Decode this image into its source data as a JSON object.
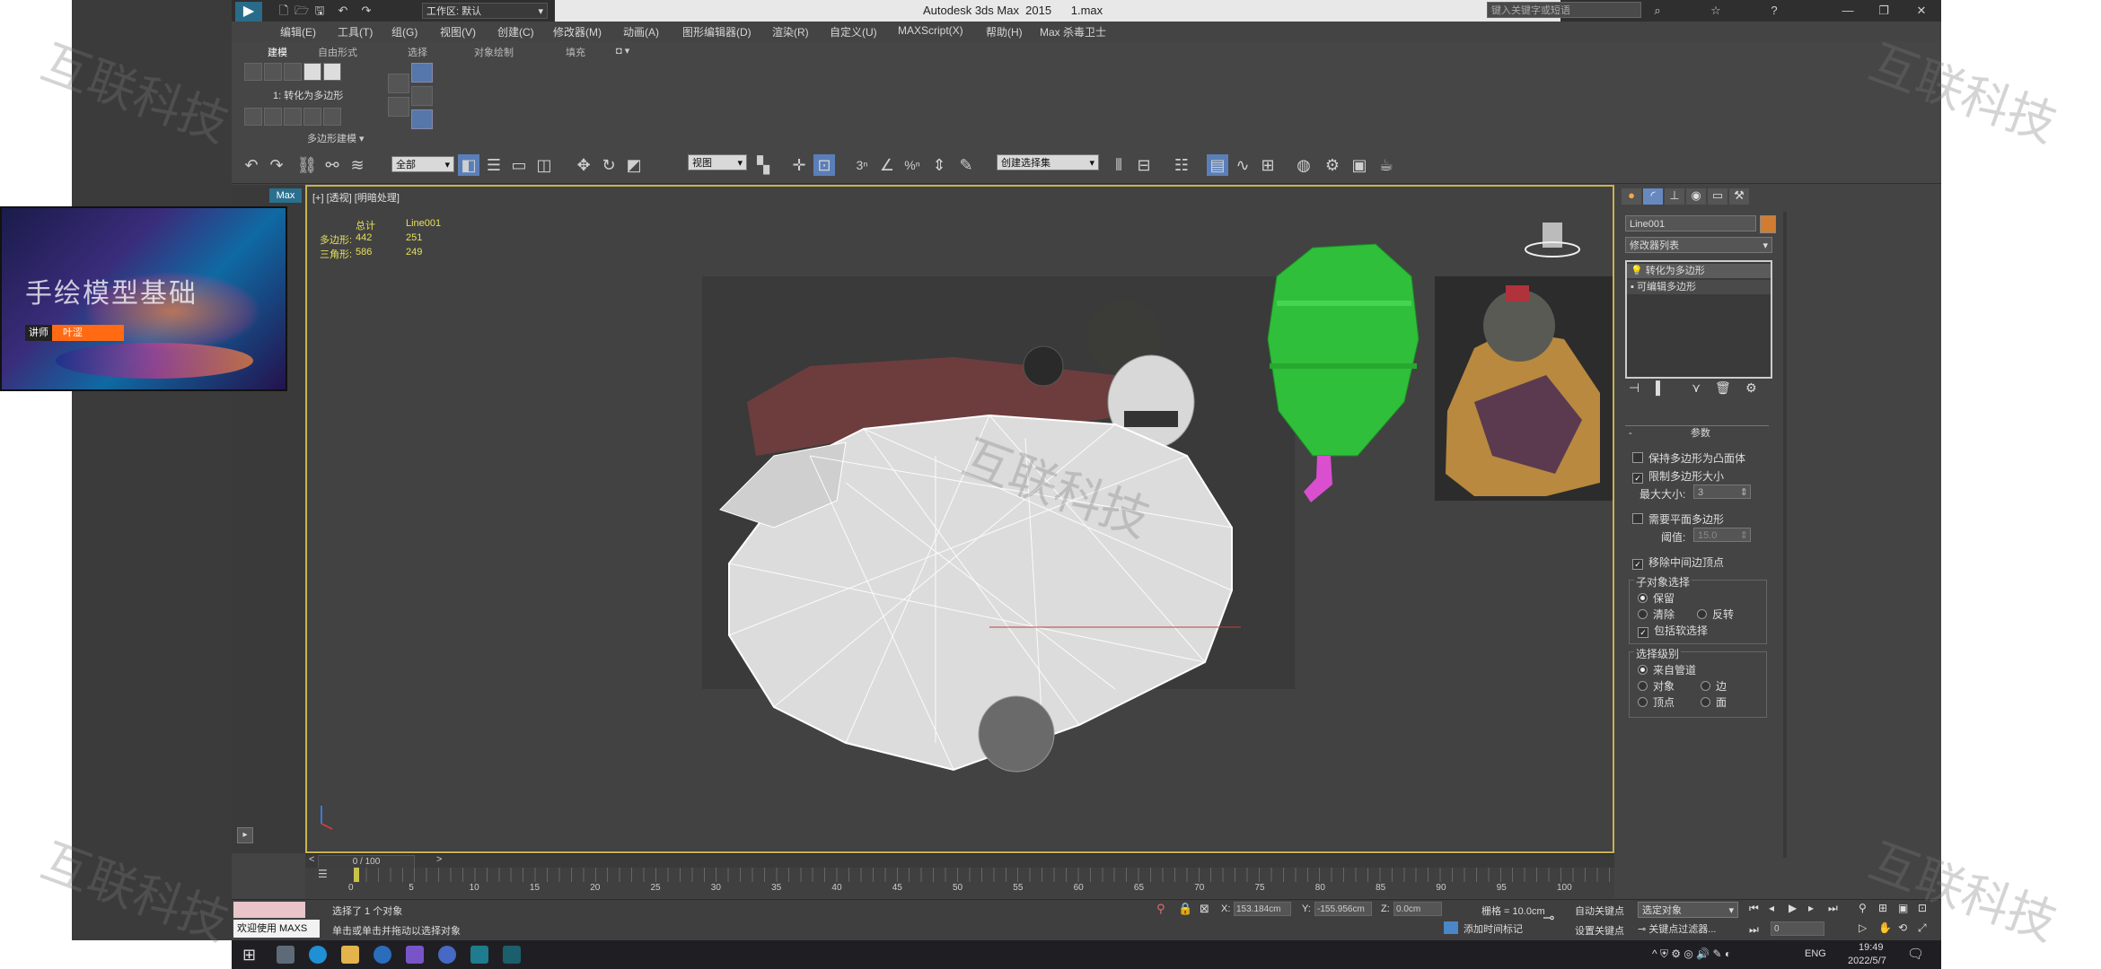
{
  "window": {
    "title": "Autodesk 3ds Max  2015      1.max",
    "workspace": "工作区: 默认",
    "search_placeholder": "键入关键字或短语"
  },
  "menu": [
    "编辑(E)",
    "工具(T)",
    "组(G)",
    "视图(V)",
    "创建(C)",
    "修改器(M)",
    "动画(A)",
    "图形编辑器(D)",
    "渲染(R)",
    "自定义(U)",
    "MAXScript(X)",
    "帮助(H)",
    "Max 杀毒卫士"
  ],
  "ribbon": {
    "tabs": [
      "建模",
      "自由形式",
      "选择",
      "对象绘制",
      "填充"
    ],
    "command_label": "1: 转化为多边形",
    "group_label": "多边形建模 ▾"
  },
  "toolbar": {
    "filter_dropdown": "全部",
    "ref_coord_dropdown": "视图",
    "named_selection_dropdown": "创建选择集"
  },
  "viewport": {
    "label": "[+] [透视] [明暗处理]",
    "stats_header": [
      "总计",
      "Line001"
    ],
    "stats": [
      {
        "label": "多边形:",
        "total": "442",
        "obj": "251"
      },
      {
        "label": "三角形:",
        "total": "586",
        "obj": "249"
      }
    ]
  },
  "command_panel": {
    "object_name": "Line001",
    "modifier_list": "修改器列表",
    "stack": [
      "转化为多边形",
      "可编辑多边形"
    ],
    "rollout_title": "参数",
    "keep_convex": "保持多边形为凸面体",
    "limit_size": "限制多边形大小",
    "max_size_label": "最大大小:",
    "max_size_value": "3",
    "require_planar": "需要平面多边形",
    "threshold_label": "阈值:",
    "threshold_value": "15.0",
    "remove_mid_verts": "移除中间边顶点",
    "subobj_title": "子对象选择",
    "subobj_keep": "保留",
    "subobj_clear": "清除",
    "subobj_invert": "反转",
    "subobj_soft": "包括软选择",
    "sel_level_title": "选择级别",
    "sel_from_pipeline": "来自管道",
    "sel_object": "对象",
    "sel_edge": "边",
    "sel_vertex": "顶点",
    "sel_face": "面"
  },
  "timeline": {
    "slider_label": "0 / 100",
    "ticks": [
      "0",
      "5",
      "10",
      "15",
      "20",
      "25",
      "30",
      "35",
      "40",
      "45",
      "50",
      "55",
      "60",
      "65",
      "70",
      "75",
      "80",
      "85",
      "90",
      "95",
      "100"
    ]
  },
  "status": {
    "maxscript_label": "欢迎使用 MAXS",
    "selected_text": "选择了 1 个对象",
    "prompt_text": "单击或单击并拖动以选择对象",
    "x_value": "153.184cm",
    "y_value": "-155.956cm",
    "z_value": "0.0cm",
    "grid_text": "栅格 = 10.0cm",
    "add_time_tag": "添加时间标记",
    "auto_key": "自动关键点",
    "set_key": "设置关键点",
    "selected_dropdown": "选定对象",
    "key_filters": "关键点过滤器...",
    "frame_value": "0"
  },
  "taskbar": {
    "lang": "ENG",
    "time": "19:49",
    "date": "2022/5/7"
  },
  "thumbnail": {
    "title": "手绘模型基础",
    "teacher_label": "讲师",
    "teacher_name": "叶涩"
  },
  "watermark": "互联科技"
}
